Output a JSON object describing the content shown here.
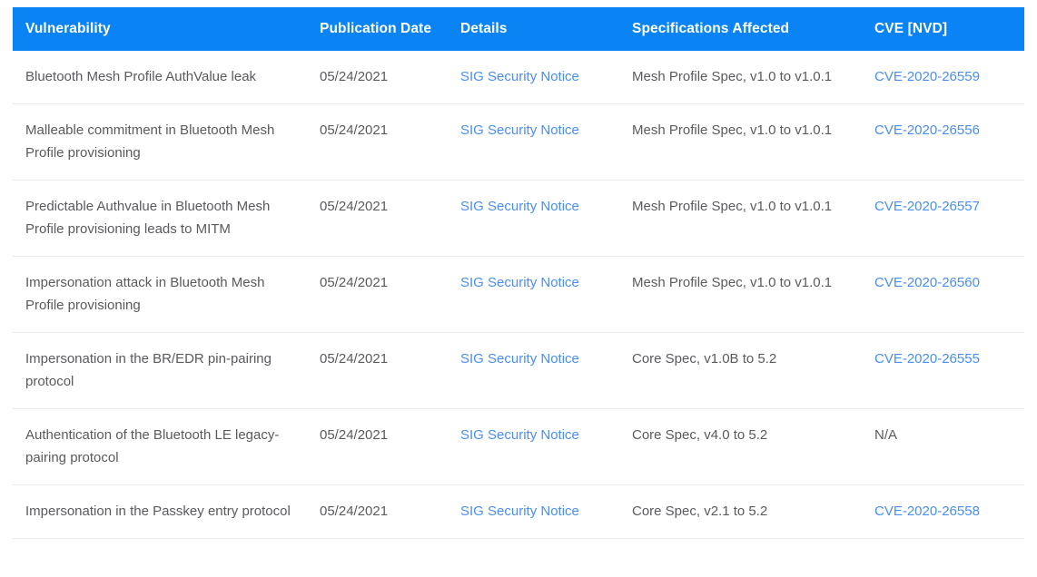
{
  "table": {
    "columns": [
      {
        "key": "vulnerability",
        "label": "Vulnerability"
      },
      {
        "key": "publication_date",
        "label": "Publication Date"
      },
      {
        "key": "details",
        "label": "Details"
      },
      {
        "key": "specifications_affected",
        "label": "Specifications Affected"
      },
      {
        "key": "cve",
        "label": "CVE [NVD]"
      }
    ],
    "colors": {
      "header_background": "#0a84f5",
      "header_text": "#ffffff",
      "body_text": "#5a5a5f",
      "link": "#4a8ef0",
      "row_divider": "#eaeaea",
      "page_background": "#ffffff"
    },
    "rows": [
      {
        "vulnerability": "Bluetooth Mesh Profile AuthValue leak",
        "publication_date": "05/24/2021",
        "details": "SIG Security Notice",
        "specifications_affected": "Mesh Profile Spec, v1.0 to v1.0.1",
        "cve": "CVE-2020-26559",
        "cve_is_link": true
      },
      {
        "vulnerability": "Malleable commitment in Bluetooth Mesh Profile provisioning",
        "publication_date": "05/24/2021",
        "details": "SIG Security Notice",
        "specifications_affected": "Mesh Profile Spec, v1.0 to v1.0.1",
        "cve": "CVE-2020-26556",
        "cve_is_link": true
      },
      {
        "vulnerability": "Predictable Authvalue in Bluetooth Mesh Profile provisioning leads to MITM",
        "publication_date": "05/24/2021",
        "details": "SIG Security Notice",
        "specifications_affected": "Mesh Profile Spec, v1.0 to v1.0.1",
        "cve": "CVE-2020-26557",
        "cve_is_link": true
      },
      {
        "vulnerability": "Impersonation attack in Bluetooth Mesh Profile provisioning",
        "publication_date": "05/24/2021",
        "details": "SIG Security Notice",
        "specifications_affected": "Mesh Profile Spec, v1.0 to v1.0.1",
        "cve": "CVE-2020-26560",
        "cve_is_link": true
      },
      {
        "vulnerability": "Impersonation in the BR/EDR pin-pairing protocol",
        "publication_date": "05/24/2021",
        "details": "SIG Security Notice",
        "specifications_affected": "Core Spec, v1.0B to 5.2",
        "cve": "CVE-2020-26555",
        "cve_is_link": true
      },
      {
        "vulnerability": "Authentication of the Bluetooth LE legacy-pairing protocol",
        "publication_date": "05/24/2021",
        "details": "SIG Security Notice",
        "specifications_affected": "Core Spec, v4.0 to 5.2",
        "cve": "N/A",
        "cve_is_link": false
      },
      {
        "vulnerability": "Impersonation in the Passkey entry protocol",
        "publication_date": "05/24/2021",
        "details": "SIG Security Notice",
        "specifications_affected": "Core Spec, v2.1 to 5.2",
        "cve": "CVE-2020-26558",
        "cve_is_link": true
      }
    ]
  }
}
